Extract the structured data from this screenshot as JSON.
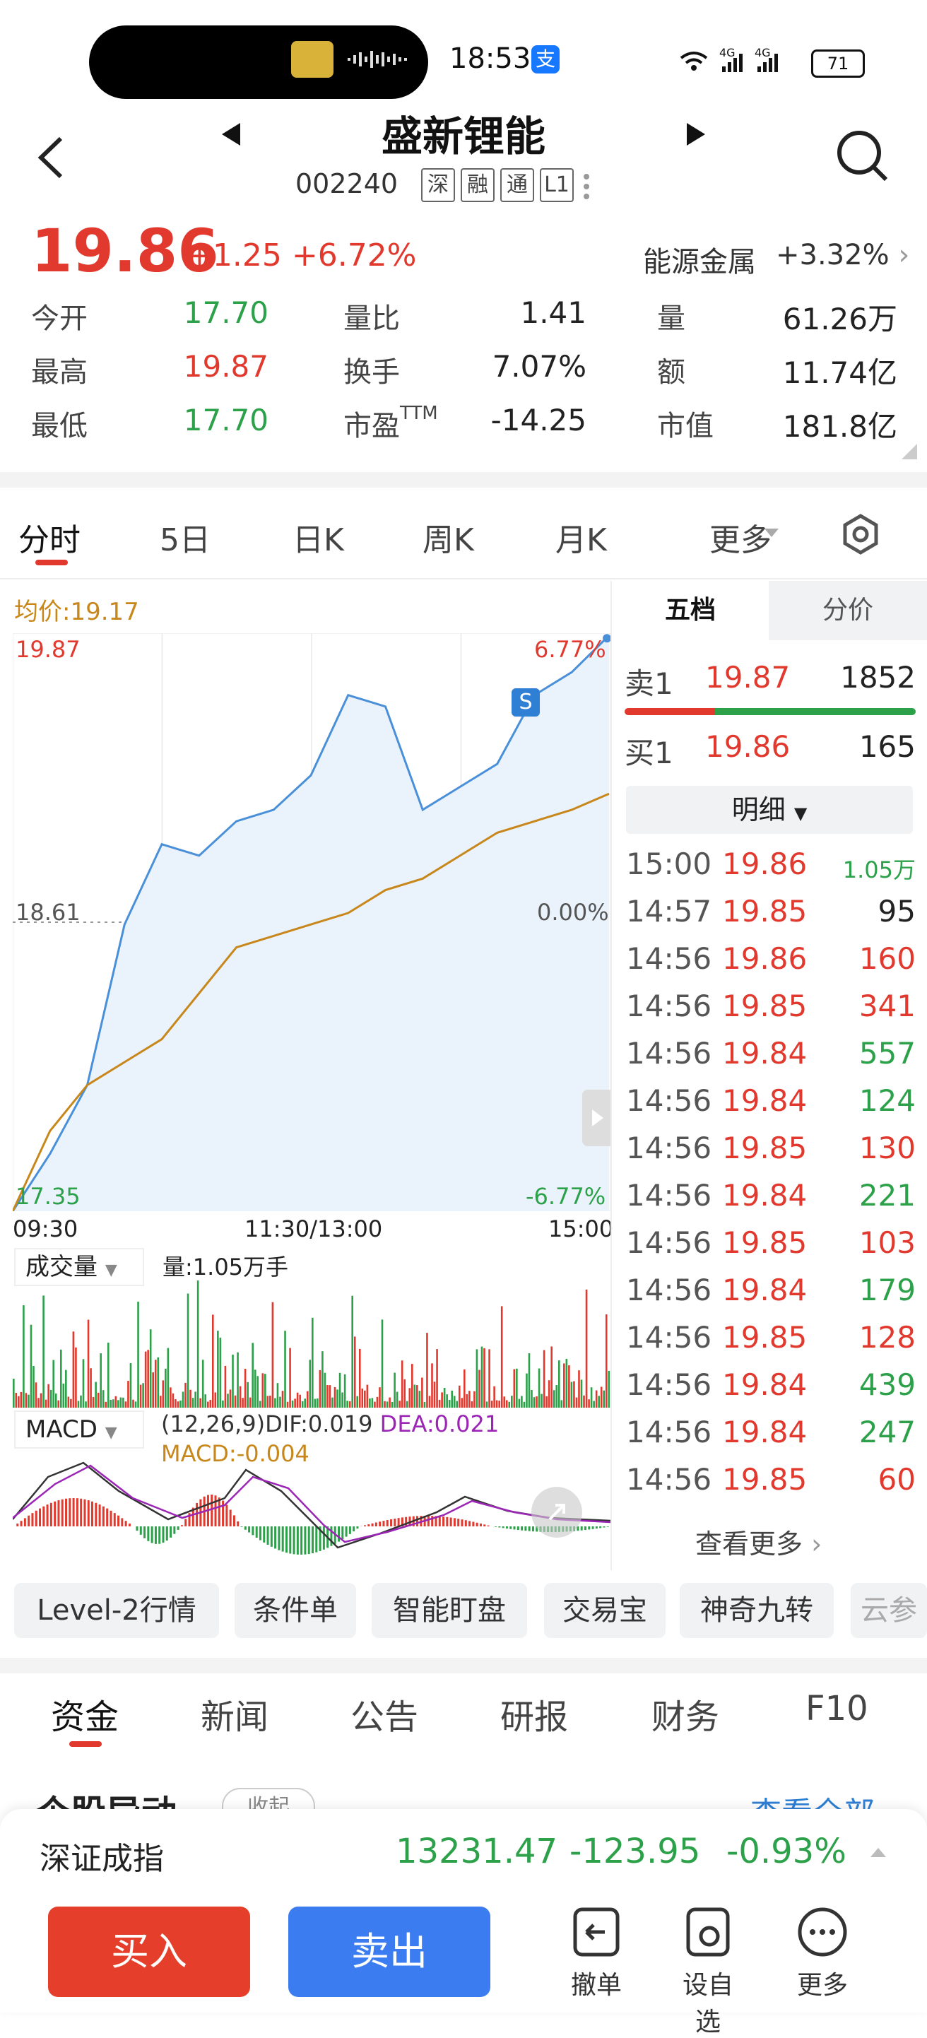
{
  "status": {
    "time": "18:53",
    "battery": "71",
    "network": "4G 4G",
    "pay": "支"
  },
  "header": {
    "title": "盛新锂能",
    "code": "002240",
    "tags": [
      "深",
      "融",
      "通",
      "L1"
    ]
  },
  "quote": {
    "price": "19.86",
    "change": "+1.25",
    "change_pct": "+6.72%",
    "sector": "能源金属",
    "sector_change": "+3.32%",
    "rows": [
      [
        {
          "label": "今开",
          "value": "17.70",
          "color": "green"
        },
        {
          "label": "量比",
          "value": "1.41",
          "color": "dark"
        },
        {
          "label": "量",
          "value": "61.26万",
          "color": "dark"
        }
      ],
      [
        {
          "label": "最高",
          "value": "19.87",
          "color": "red"
        },
        {
          "label": "换手",
          "value": "7.07%",
          "color": "dark"
        },
        {
          "label": "额",
          "value": "11.74亿",
          "color": "dark"
        }
      ],
      [
        {
          "label": "最低",
          "value": "17.70",
          "color": "green"
        },
        {
          "label": "市盈TTM",
          "value": "-14.25",
          "color": "dark"
        },
        {
          "label": "市值",
          "value": "181.8亿",
          "color": "dark"
        }
      ]
    ]
  },
  "chart_tabs": [
    "分时",
    "5日",
    "日K",
    "周K",
    "月K",
    "更多"
  ],
  "chart": {
    "avg_price": "均价:19.17",
    "high": "19.87",
    "high_pct": "6.77%",
    "mid": "18.61",
    "mid_pct": "0.00%",
    "low": "17.35",
    "low_pct": "-6.77%",
    "time_labels": [
      "09:30",
      "11:30/13:00",
      "15:00"
    ],
    "volume_label": "成交量",
    "volume_info": "量:1.05万手",
    "macd_label": "MACD",
    "macd_params": "(12,26,9)DIF:0.019",
    "macd_dea": "DEA:0.021",
    "macd_value": "MACD:-0.004",
    "marker": "S"
  },
  "chart_data": {
    "type": "line",
    "title": "",
    "x": [
      "09:30",
      "11:30/13:00",
      "15:00"
    ],
    "series": [
      {
        "values": [
          17.35,
          17.6,
          17.9,
          18.6,
          18.95,
          18.9,
          19.05,
          19.1,
          19.25,
          19.6,
          19.55,
          19.1,
          19.2,
          19.3,
          19.6,
          19.7,
          19.86
        ]
      },
      {
        "values": [
          17.35,
          17.7,
          17.9,
          18.0,
          18.1,
          18.3,
          18.5,
          18.55,
          18.6,
          18.65,
          18.75,
          18.8,
          18.9,
          19.0,
          19.05,
          19.1,
          19.17
        ]
      }
    ],
    "ylim": [
      17.35,
      19.87
    ]
  },
  "order_book": {
    "tabs": [
      "五档",
      "分价"
    ],
    "sell": {
      "label": "卖1",
      "price": "19.87",
      "vol": "1852"
    },
    "buy": {
      "label": "买1",
      "price": "19.86",
      "vol": "165"
    },
    "detail_label": "明细",
    "more_label": "查看更多"
  },
  "ticks": [
    {
      "t": "15:00",
      "p": "19.86",
      "v": "1.05万",
      "c": "green"
    },
    {
      "t": "14:57",
      "p": "19.85",
      "v": "95",
      "c": "dark"
    },
    {
      "t": "14:56",
      "p": "19.86",
      "v": "160",
      "c": "red"
    },
    {
      "t": "14:56",
      "p": "19.85",
      "v": "341",
      "c": "red"
    },
    {
      "t": "14:56",
      "p": "19.84",
      "v": "557",
      "c": "green"
    },
    {
      "t": "14:56",
      "p": "19.84",
      "v": "124",
      "c": "green"
    },
    {
      "t": "14:56",
      "p": "19.85",
      "v": "130",
      "c": "red"
    },
    {
      "t": "14:56",
      "p": "19.84",
      "v": "221",
      "c": "green"
    },
    {
      "t": "14:56",
      "p": "19.85",
      "v": "103",
      "c": "red"
    },
    {
      "t": "14:56",
      "p": "19.84",
      "v": "179",
      "c": "green"
    },
    {
      "t": "14:56",
      "p": "19.85",
      "v": "128",
      "c": "red"
    },
    {
      "t": "14:56",
      "p": "19.84",
      "v": "439",
      "c": "green"
    },
    {
      "t": "14:56",
      "p": "19.84",
      "v": "247",
      "c": "green"
    },
    {
      "t": "14:56",
      "p": "19.85",
      "v": "60",
      "c": "red"
    }
  ],
  "features": [
    "Level-2行情",
    "条件单",
    "智能盯盘",
    "交易宝",
    "神奇九转",
    "云参"
  ],
  "bottom_tabs": [
    "资金",
    "新闻",
    "公告",
    "研报",
    "财务",
    "F10"
  ],
  "section": {
    "title": "个股异动",
    "collapse": "收起",
    "view_all": "查看全部"
  },
  "index_bar": {
    "name": "深证成指",
    "value": "13231.47",
    "change": "-123.95",
    "pct": "-0.93%"
  },
  "actions": {
    "buy": "买入",
    "sell": "卖出",
    "cancel": "撤单",
    "watch": "设自选",
    "more": "更多"
  },
  "colors": {
    "red": "#e2392e",
    "green": "#2ca14a",
    "line": "#4a90d9",
    "avg": "#c8871a",
    "buy_btn": "#e53e2a",
    "sell_btn": "#3b7cf0"
  }
}
